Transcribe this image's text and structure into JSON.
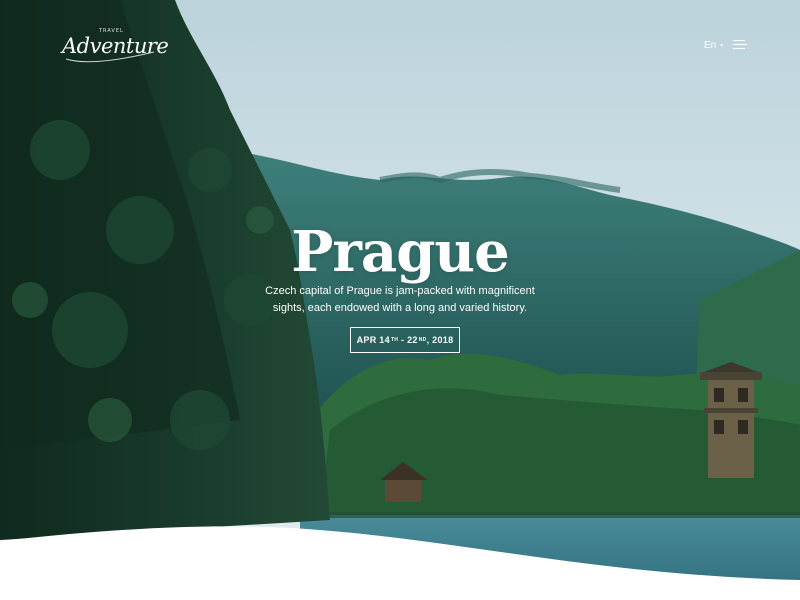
{
  "header": {
    "logo_small": "TRAVEL",
    "logo_text": "Adventure",
    "language": "En",
    "menu_icon": "hamburger-menu-icon"
  },
  "hero": {
    "title": "Prague",
    "description": "Czech capital of Prague is jam-packed with magnificent sights, each endowed with a long and varied history.",
    "date_start": "APR 14",
    "date_start_suffix": "TH",
    "date_separator": " - ",
    "date_end": "22",
    "date_end_suffix": "ND",
    "date_year": ", 2018"
  },
  "colors": {
    "sky": "#c9dde5",
    "mountain": "#2f6f6a",
    "forest_dark": "#173628",
    "water": "#3d7c8c",
    "text": "#ffffff"
  }
}
